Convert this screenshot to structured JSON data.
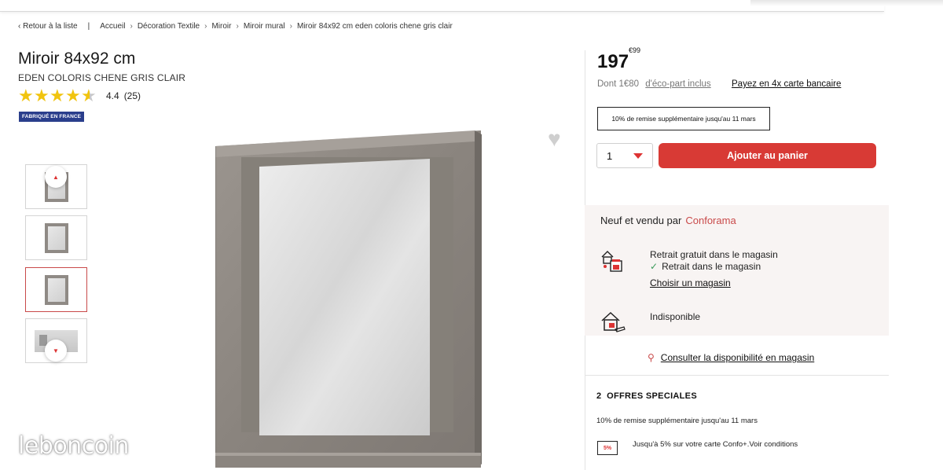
{
  "breadcrumb": {
    "back": "Retour à la liste",
    "items": [
      "Accueil",
      "Décoration Textile",
      "Miroir",
      "Miroir mural",
      "Miroir 84x92 cm eden coloris chene gris clair"
    ]
  },
  "product": {
    "title": "Miroir 84x92 cm",
    "subtitle": "EDEN COLORIS CHENE GRIS CLAIR",
    "rating_value": "4.4",
    "rating_count": "(25)",
    "rating_stars": 4.4,
    "badge": "FABRIQUÉ EN FRANCE"
  },
  "pricing": {
    "price_main": "197",
    "price_cents": "€99",
    "eco_prefix": "Dont 1€80",
    "eco_link": "d'éco-part inclus",
    "installments": "Payez en 4x carte bancaire",
    "promo": "10% de remise supplémentaire jusqu'au 11 mars"
  },
  "cart": {
    "quantity": "1",
    "add_label": "Ajouter au panier"
  },
  "seller": {
    "prefix": "Neuf et vendu par",
    "name": "Conforama",
    "pickup_title": "Retrait gratuit dans le magasin",
    "pickup_status": "Retrait dans le magasin",
    "choose_store": "Choisir un magasin",
    "home_delivery": "Indisponible",
    "check_availability": "Consulter la disponibilité en magasin"
  },
  "offers": {
    "count": "2",
    "title": "OFFRES SPECIALES",
    "offer1": "10% de remise supplémentaire jusqu'au 11 mars",
    "offer2": "Jusqu'à 5% sur votre carte Confo+.Voir conditions",
    "offer2_icon_text": "5%"
  },
  "watermark": "leboncoin",
  "colors": {
    "accent": "#d83a35",
    "brand": "#c94a4a",
    "badge": "#2a3e8c",
    "star": "#f1c40f",
    "frame": "#8f8a85"
  }
}
